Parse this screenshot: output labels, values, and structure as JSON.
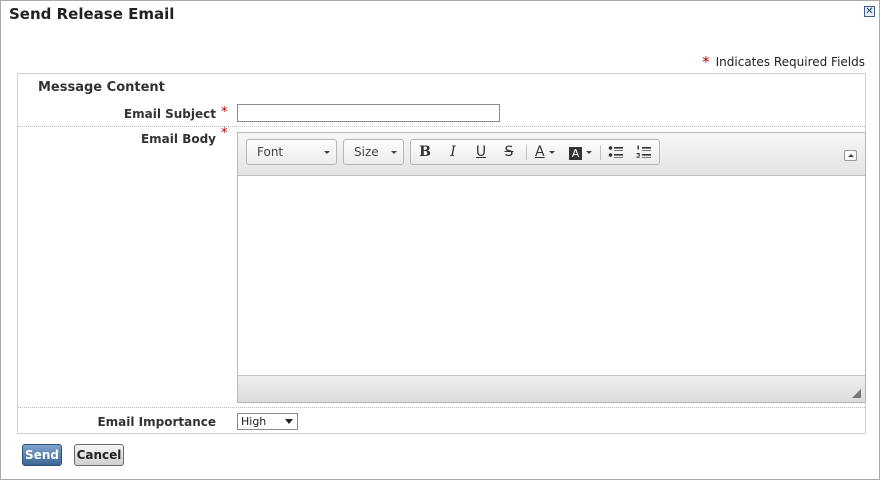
{
  "dialog": {
    "title": "Send Release Email",
    "close_icon": "close-icon"
  },
  "required_note": {
    "marker": "*",
    "text": "Indicates Required Fields"
  },
  "form": {
    "section_title": "Message Content",
    "required_marker": "*",
    "email_subject": {
      "label": "Email Subject",
      "value": ""
    },
    "email_body": {
      "label": "Email Body",
      "toolbar": {
        "font_label": "Font",
        "size_label": "Size",
        "buttons": [
          "bold-icon",
          "italic-icon",
          "underline-icon",
          "strikethrough-icon",
          "text-color-icon",
          "background-color-icon",
          "bulleted-list-icon",
          "numbered-list-icon"
        ],
        "bold": "B",
        "italic": "I",
        "underline": "U",
        "strike": "S",
        "text_color": "A",
        "bg_color": "A"
      },
      "content": ""
    },
    "email_importance": {
      "label": "Email Importance",
      "value": "High"
    }
  },
  "actions": {
    "send_label": "Send",
    "cancel_label": "Cancel"
  },
  "colors": {
    "required": "#bb0000",
    "send_button": "#3c6696"
  }
}
